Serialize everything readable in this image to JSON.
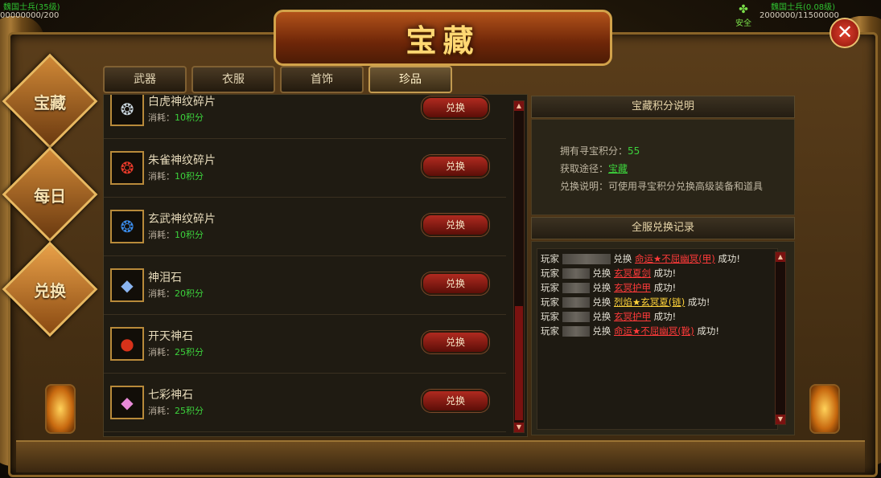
{
  "window": {
    "title": "宝藏",
    "close_label": "✕",
    "safe_label": "安全",
    "top_left_name": "魏国士兵(35级)",
    "top_left_value": "00000000/200",
    "top_right_name": "魏国士兵(0.08级)",
    "top_right_value": "2000000/11500000"
  },
  "tabs": [
    {
      "label": "武器",
      "active": false
    },
    {
      "label": "衣服",
      "active": false
    },
    {
      "label": "首饰",
      "active": false
    },
    {
      "label": "珍品",
      "active": true
    }
  ],
  "side_nav": [
    {
      "label": "宝藏",
      "active": false
    },
    {
      "label": "每日",
      "active": false
    },
    {
      "label": "兑换",
      "active": true
    }
  ],
  "items": [
    {
      "name": "白虎神纹碎片",
      "cost_prefix": "消耗：",
      "cost": "10积分",
      "icon": "white-tiger-shard-icon",
      "glyph": "❂",
      "color": "#c8d4dc",
      "button": "兑换"
    },
    {
      "name": "朱雀神纹碎片",
      "cost_prefix": "消耗：",
      "cost": "10积分",
      "icon": "vermilion-bird-shard-icon",
      "glyph": "❂",
      "color": "#e83a2a",
      "button": "兑换"
    },
    {
      "name": "玄武神纹碎片",
      "cost_prefix": "消耗：",
      "cost": "10积分",
      "icon": "black-tortoise-shard-icon",
      "glyph": "❂",
      "color": "#3a8ae8",
      "button": "兑换"
    },
    {
      "name": "神泪石",
      "cost_prefix": "消耗：",
      "cost": "20积分",
      "icon": "divine-tear-stone-icon",
      "glyph": "◆",
      "color": "#8ab4f0",
      "button": "兑换"
    },
    {
      "name": "开天神石",
      "cost_prefix": "消耗：",
      "cost": "25积分",
      "icon": "sky-opening-stone-icon",
      "glyph": "●",
      "color": "#d8321a",
      "button": "兑换"
    },
    {
      "name": "七彩神石",
      "cost_prefix": "消耗：",
      "cost": "25积分",
      "icon": "rainbow-stone-icon",
      "glyph": "◆",
      "color": "#e88ad8",
      "button": "兑换"
    }
  ],
  "info": {
    "header": "宝藏积分说明",
    "points_label": "拥有寻宝积分：",
    "points_value": "55",
    "source_label": "获取途径：",
    "source_link": "宝藏",
    "desc_label": "兑换说明：",
    "desc_text": "可使用寻宝积分兑换高级装备和道具"
  },
  "log": {
    "header": "全服兑换记录",
    "rows": [
      {
        "prefix": "玩家",
        "action": "兑换",
        "item": "命运★不屈幽冥(甲)",
        "suffix": "成功!",
        "wide": true
      },
      {
        "prefix": "玩家",
        "action": "兑换",
        "item": "玄冥夏剑",
        "suffix": "成功!",
        "wide": false
      },
      {
        "prefix": "玩家",
        "action": "兑换",
        "item": "玄冥护甲",
        "suffix": "成功!",
        "wide": false
      },
      {
        "prefix": "玩家",
        "action": "兑换",
        "item": "烈焰★玄冥夏(链)",
        "suffix": "成功!",
        "wide": false,
        "yellow": true
      },
      {
        "prefix": "玩家",
        "action": "兑换",
        "item": "玄冥护甲",
        "suffix": "成功!",
        "wide": false
      },
      {
        "prefix": "玩家",
        "action": "兑换",
        "item": "命运★不屈幽冥(靴)",
        "suffix": "成功!",
        "wide": false
      }
    ]
  }
}
